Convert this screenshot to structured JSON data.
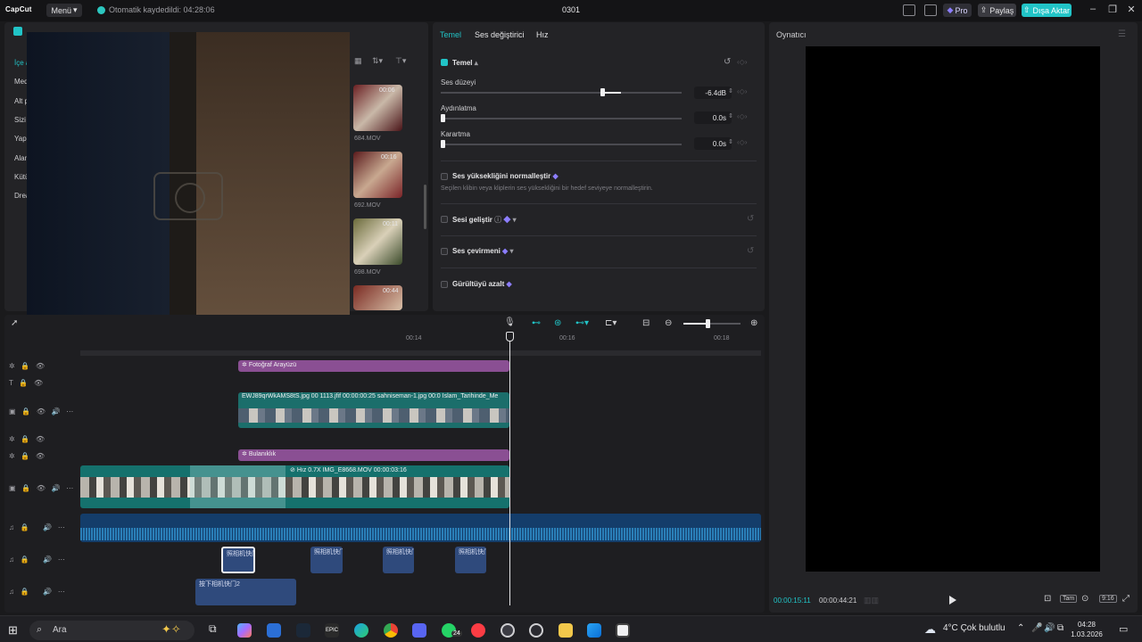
{
  "app": {
    "logo_text": "CapCut",
    "menu_label": "Menü",
    "autosave_text": "Otomatik kaydedildi: 04:28:06",
    "project_title": "0301",
    "pro_label": "Pro",
    "share_label": "Paylaş",
    "export_label": "Dışa Aktar"
  },
  "media_panel": {
    "sidebar_items": [
      "İçe a",
      "Med",
      "Alt p",
      "Sizi",
      "Yap",
      "Alan",
      "Kütü",
      "Drea"
    ],
    "thumbnails": [
      {
        "duration": "00:06",
        "name": "684.MOV"
      },
      {
        "duration": "00:16",
        "name": "692.MOV"
      },
      {
        "duration": "00:11",
        "name": "698.MOV"
      },
      {
        "duration": "00:44",
        "name": ""
      }
    ]
  },
  "properties": {
    "tabs": [
      "Temel",
      "Ses değiştirici",
      "Hız"
    ],
    "active_tab": "Temel",
    "section_title": "Temel",
    "sliders": [
      {
        "label": "Ses düzeyi",
        "value": "-6.4dB",
        "level": 0.62
      },
      {
        "label": "Aydınlatma",
        "value": "0.0s",
        "level": 0.0
      },
      {
        "label": "Karartma",
        "value": "0.0s",
        "level": 0.0
      }
    ],
    "normalize_label": "Ses yüksekliğini normalleştir",
    "normalize_desc": "Seçilen klibin veya kliplerin ses yüksekliğini bir hedef seviyeye normalleştirin.",
    "enhance_label": "Sesi geliştir",
    "convert_label": "Ses çevirmeni",
    "denoise_label": "Gürültüyü azalt"
  },
  "player": {
    "title": "Oynatıcı",
    "current_time": "00:00:15:11",
    "total_time": "00:00:44:21",
    "ratio_label": "Tam",
    "aspect_label": "9:16"
  },
  "timeline": {
    "ruler": [
      "00:14",
      "00:16",
      "00:18"
    ],
    "clips": {
      "fx1": "Fotoğraf Arayüzü",
      "photo": "EWJ89qrWkAMS8tS.jpg  00  1113.jfif  00:00:00:25  sahniseman-1.jpg  00:0  İslam_Tarihinde_Me",
      "fx2": "Bulanıklık",
      "video": "Hız 0.7X  IMG_E8668.MOV  00:00:03:16",
      "sfx": [
        "照相机快门",
        "照相机快门",
        "照相机快门",
        "照相机快门"
      ],
      "sfx2": "按下相机快门2"
    }
  },
  "taskbar": {
    "search_placeholder": "Ara",
    "badge": "24",
    "weather_temp": "4°C",
    "weather_text": "Çok bulutlu",
    "time": "04:28",
    "date": "1.03.2026"
  },
  "colors": {
    "accent": "#21c4c7",
    "fx_clip": "#8a4f93",
    "video_clip": "#15716d",
    "audio_clip": "#143d6a"
  }
}
